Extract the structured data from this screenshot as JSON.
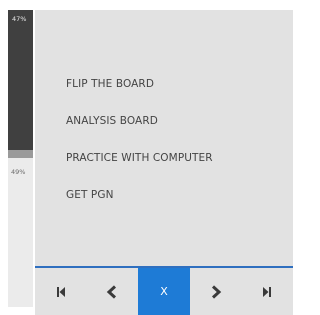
{
  "evaluation": {
    "top_label": "47%",
    "bottom_label": "49%",
    "top_share": 0.47
  },
  "menu": {
    "items": [
      {
        "id": "flip",
        "label": "FLIP THE BOARD"
      },
      {
        "id": "analysis",
        "label": "ANALYSIS BOARD"
      },
      {
        "id": "practice",
        "label": "PRACTICE WITH COMPUTER"
      },
      {
        "id": "pgn",
        "label": "GET PGN"
      }
    ]
  },
  "nav": {
    "buttons": [
      {
        "id": "first",
        "icon": "skip-to-start-icon"
      },
      {
        "id": "previous",
        "icon": "chevron-left-icon"
      },
      {
        "id": "close",
        "icon": "close-icon",
        "label": "X",
        "active": true
      },
      {
        "id": "next",
        "icon": "chevron-right-icon"
      },
      {
        "id": "last",
        "icon": "skip-to-end-icon"
      }
    ]
  },
  "colors": {
    "accent": "#1e7bd6",
    "panel": "#e2e2e2",
    "eval_dark": "#404040",
    "eval_light": "#ebebeb"
  }
}
